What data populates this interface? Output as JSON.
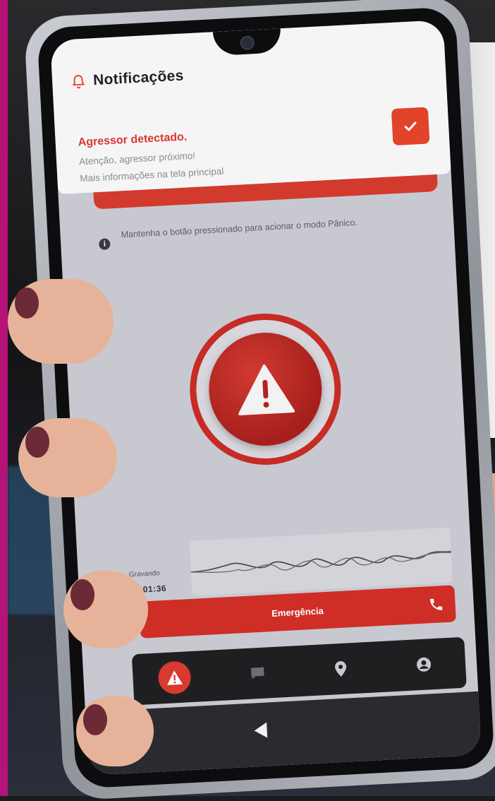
{
  "notification": {
    "header_title": "Notificações",
    "alert_title": "Agressor detectado.",
    "alert_line1": "Atenção, agressor próximo!",
    "alert_line2": "Mais informações na tela principal",
    "icons": {
      "bell": "bell-icon",
      "confirm": "check-icon"
    },
    "accent_color": "#e2432b"
  },
  "panic": {
    "hint_text": "Mantenha o botão pressionado para acionar o modo Pânico.",
    "button_icon": "warning-triangle-icon",
    "ring_color": "#c62b25"
  },
  "recording": {
    "label": "Gravando",
    "time": "00:01:36"
  },
  "emergency": {
    "label": "Emergência",
    "icon": "phone-icon",
    "color": "#cf2e26"
  },
  "bottom_nav": {
    "items": [
      {
        "id": "alert",
        "icon": "warning-icon",
        "active": true
      },
      {
        "id": "chat",
        "icon": "chat-icon",
        "active": false
      },
      {
        "id": "map",
        "icon": "location-pin-icon",
        "active": false
      },
      {
        "id": "profile",
        "icon": "user-icon",
        "active": false
      }
    ]
  },
  "system_nav": {
    "back_icon": "back-triangle-icon"
  }
}
